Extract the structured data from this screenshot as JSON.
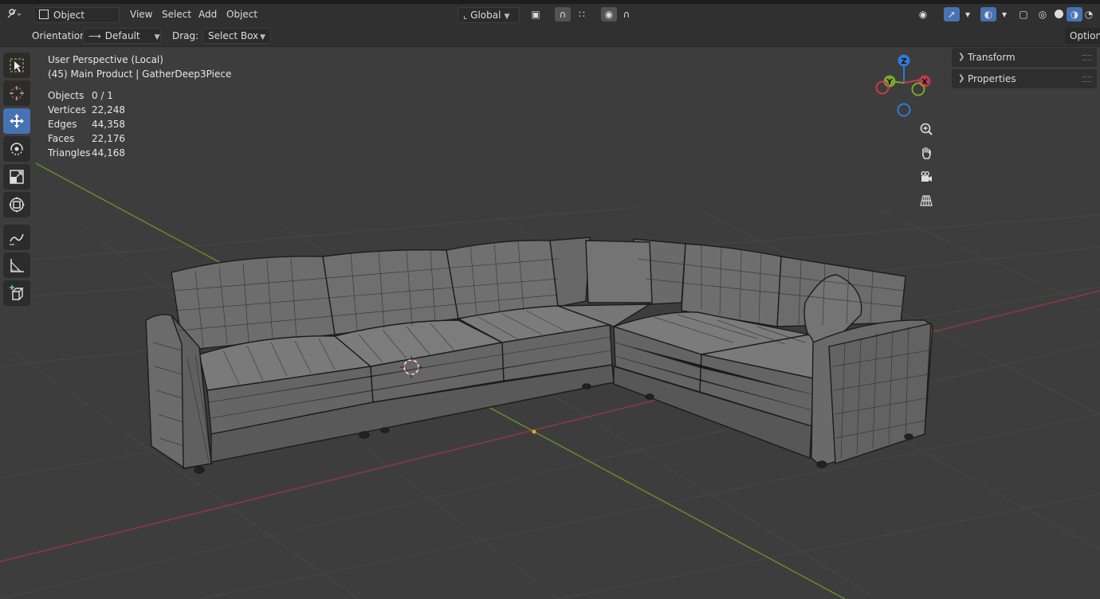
{
  "header": {
    "mode_label": "Object Mode",
    "menu": [
      "View",
      "Select",
      "Add",
      "Object"
    ],
    "transform_orientation": "Global"
  },
  "tool_settings": {
    "orientation_label": "Orientation:",
    "orientation_value": "Default",
    "drag_label": "Drag:",
    "drag_value": "Select Box",
    "options_label": "Options"
  },
  "viewport": {
    "view_name": "User Perspective (Local)",
    "object_info": "(45) Main Product | GatherDeep3Piece",
    "stats": [
      {
        "label": "Objects",
        "value": "0 / 1"
      },
      {
        "label": "Vertices",
        "value": "22,248"
      },
      {
        "label": "Edges",
        "value": "44,358"
      },
      {
        "label": "Faces",
        "value": "22,176"
      },
      {
        "label": "Triangles",
        "value": "44,168"
      }
    ]
  },
  "gizmo": {
    "z": "Z",
    "y": "Y",
    "x": "X"
  },
  "sidebar": {
    "panels": [
      "Transform",
      "Properties"
    ]
  },
  "colors": {
    "accent": "#4772b3",
    "x_axis": "#c43b4f",
    "y_axis": "#7ea52a",
    "z_axis": "#2f79d6",
    "viewport_bg": "#3d3d3d",
    "grid": "#474747"
  },
  "icons": {
    "tools": [
      "select-box-icon",
      "cursor-icon",
      "move-icon",
      "rotate-icon",
      "scale-icon",
      "transform-icon",
      "annotate-icon",
      "measure-icon",
      "add-cube-icon"
    ],
    "nav": [
      "zoom-icon",
      "pan-hand-icon",
      "camera-icon",
      "perspective-grid-icon"
    ]
  }
}
